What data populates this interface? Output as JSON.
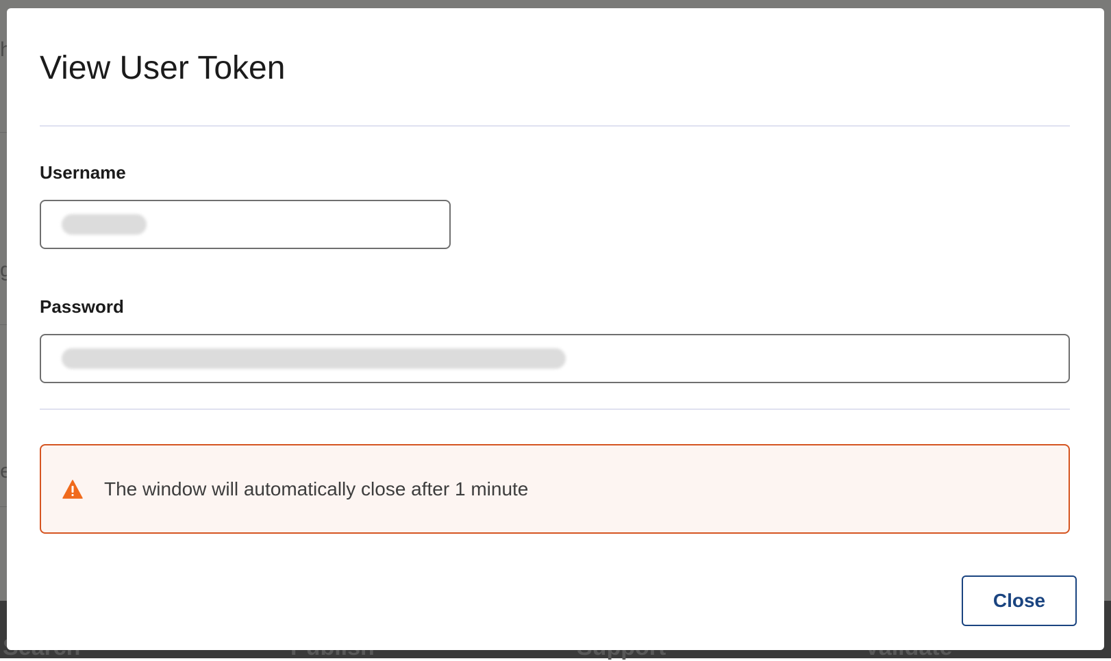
{
  "background": {
    "footer_items": [
      "Search",
      "Publish",
      "Support",
      "Validate"
    ],
    "edge_glyphs": [
      "h",
      "g",
      "e"
    ]
  },
  "modal": {
    "title": "View User Token",
    "username": {
      "label": "Username",
      "value": ""
    },
    "password": {
      "label": "Password",
      "value": ""
    },
    "alert": {
      "icon": "warning-triangle-icon",
      "message": "The window will automatically close after 1 minute",
      "color": "#d55420"
    },
    "close_button": {
      "label": "Close",
      "color": "#1a4480"
    }
  }
}
